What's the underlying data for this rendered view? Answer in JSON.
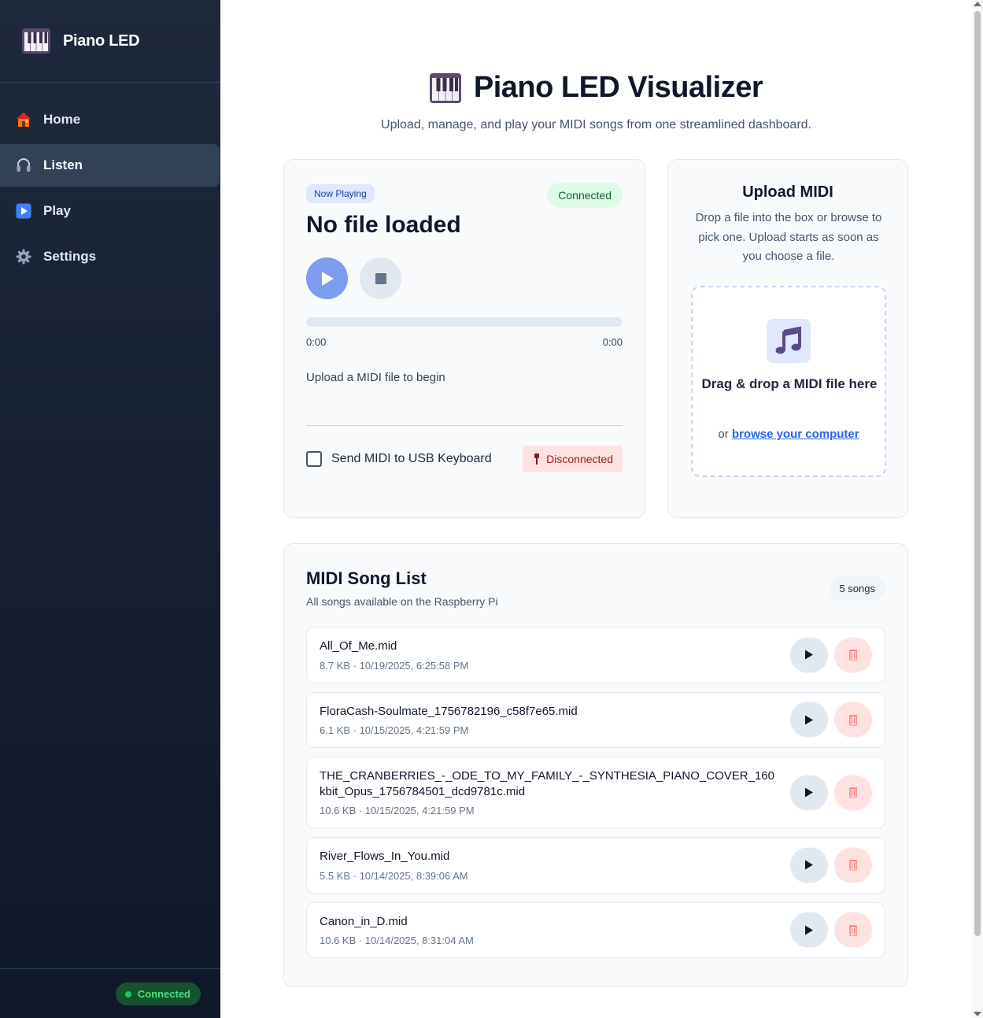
{
  "sidebar": {
    "brand": {
      "title": "Piano LED",
      "icon": "piano-icon"
    },
    "items": [
      {
        "label": "Home",
        "icon": "house-icon",
        "active": false
      },
      {
        "label": "Listen",
        "icon": "headphones-icon",
        "active": true
      },
      {
        "label": "Play",
        "icon": "play-icon",
        "active": false
      },
      {
        "label": "Settings",
        "icon": "gear-icon",
        "active": false
      }
    ],
    "footer": {
      "status": "Connected"
    }
  },
  "header": {
    "title": "Piano LED Visualizer",
    "subtitle": "Upload, manage, and play your MIDI songs from one streamlined dashboard."
  },
  "player": {
    "tag": "Now Playing",
    "connection": "Connected",
    "title": "No file loaded",
    "progress": 0,
    "time_elapsed": "0:00",
    "time_total": "0:00",
    "status": "Upload a MIDI file to begin",
    "usb_label": "Send MIDI to USB Keyboard",
    "usb_checked": false,
    "usb_status": "Disconnected"
  },
  "upload": {
    "title": "Upload MIDI",
    "description": "Drop a file into the box or browse to pick one. Upload starts as soon as you choose a file.",
    "drop_title": "Drag & drop a MIDI file here",
    "or_text": "or ",
    "browse_label": "browse your computer"
  },
  "songs": {
    "title": "MIDI Song List",
    "subtitle": "All songs available on the Raspberry Pi",
    "count_label": "5 songs",
    "items": [
      {
        "name": "All_Of_Me.mid",
        "meta": "8.7 KB · 10/19/2025, 6:25:58 PM"
      },
      {
        "name": "FloraCash-Soulmate_1756782196_c58f7e65.mid",
        "meta": "6.1 KB · 10/15/2025, 4:21:59 PM"
      },
      {
        "name": "THE_CRANBERRIES_-_ODE_TO_MY_FAMILY_-_SYNTHESIA_PIANO_COVER_160kbit_Opus_1756784501_dcd9781c.mid",
        "meta": "10.6 KB · 10/15/2025, 4:21:59 PM"
      },
      {
        "name": "River_Flows_In_You.mid",
        "meta": "5.5 KB · 10/14/2025, 8:39:06 AM"
      },
      {
        "name": "Canon_in_D.mid",
        "meta": "10.6 KB · 10/14/2025, 8:31:04 AM"
      }
    ]
  },
  "colors": {
    "sidebar_bg": "#1e293b",
    "accent": "#7c9cf0",
    "connected_bg": "#dcfce7",
    "disconnected_bg": "#fee2e2"
  }
}
